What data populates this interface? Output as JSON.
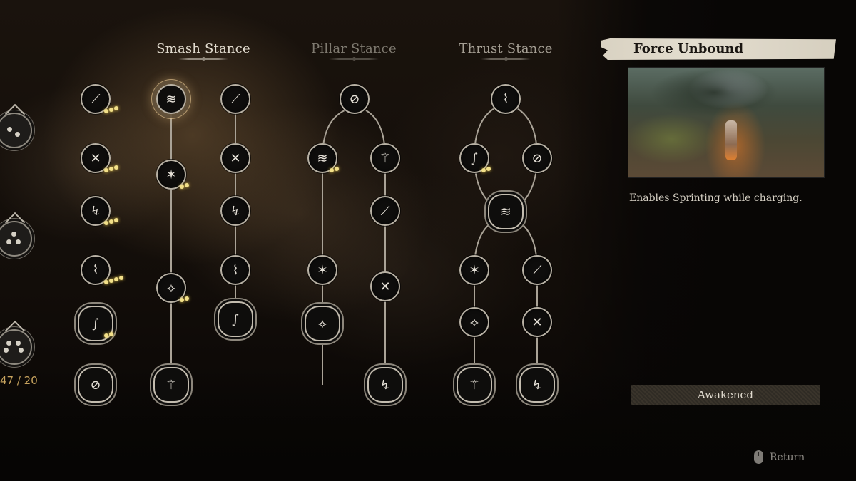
{
  "tabs": [
    {
      "label": "Smash Stance",
      "state": "active"
    },
    {
      "label": "Pillar Stance",
      "state": "inactive"
    },
    {
      "label": "Thrust Stance",
      "state": "inactive"
    }
  ],
  "sidebar": {
    "emblems": [
      {
        "name": "focus-level-2",
        "pips": 2
      },
      {
        "name": "focus-level-3",
        "pips": 3
      },
      {
        "name": "focus-level-4",
        "pips": 4
      }
    ],
    "points_label": "47 / 20"
  },
  "skill_trees": {
    "common_column": [
      {
        "icon": "orb-spin-icon",
        "cost": 3
      },
      {
        "icon": "staff-twirl-icon",
        "cost": 3
      },
      {
        "icon": "hook-strike-icon",
        "cost": 3
      },
      {
        "icon": "staff-charge-icon",
        "cost": 4
      },
      {
        "icon": "staff-coil-icon",
        "cost": 2,
        "type": "major"
      },
      {
        "icon": "staff-spin-icon",
        "cost": 0,
        "type": "major"
      }
    ],
    "smash": {
      "left": [
        {
          "icon": "smash-leap-icon",
          "state": "selected"
        },
        {
          "icon": "smash-shield-icon",
          "cost": 2
        },
        {
          "icon": "smash-burst-icon",
          "cost": 2
        },
        {
          "icon": "smash-finisher-icon",
          "type": "major"
        }
      ],
      "right": [
        {
          "icon": "cross-staff-icon"
        },
        {
          "icon": "deflect-icon"
        },
        {
          "icon": "crescent-icon"
        },
        {
          "icon": "crescent-focus-icon"
        },
        {
          "icon": "cross-focus-icon",
          "type": "major"
        }
      ]
    },
    "pillar": {
      "root": {
        "icon": "pillar-stand-icon"
      },
      "left": [
        {
          "icon": "pillar-grass-icon",
          "cost": 2
        },
        {
          "icon": "pillar-lean-icon"
        },
        {
          "icon": "pillar-swing-icon",
          "type": "major"
        }
      ],
      "right": [
        {
          "icon": "pillar-spin-icon"
        },
        {
          "icon": "pillar-whirl-icon"
        },
        {
          "icon": "pillar-cross-icon"
        },
        {
          "icon": "pillar-fan-icon",
          "type": "major"
        }
      ]
    },
    "thrust": {
      "root": {
        "icon": "thrust-line-icon"
      },
      "upper_left": {
        "icon": "thrust-wave-icon",
        "cost": 2
      },
      "upper_right": {
        "icon": "thrust-glide-icon"
      },
      "hub": {
        "icon": "force-unbound-icon",
        "type": "major"
      },
      "left": [
        {
          "icon": "thrust-pierce-icon"
        },
        {
          "icon": "thrust-feather-icon"
        },
        {
          "icon": "thrust-surge-icon",
          "type": "major"
        }
      ],
      "right": [
        {
          "icon": "thrust-sweep-icon"
        },
        {
          "icon": "thrust-ring-icon"
        },
        {
          "icon": "thrust-star-icon",
          "type": "major"
        }
      ]
    }
  },
  "detail": {
    "title": "Force Unbound",
    "description": "Enables Sprinting while charging.",
    "status_label": "Awakened"
  },
  "footer": {
    "return_label": "Return",
    "return_icon": "mouse-icon"
  },
  "colors": {
    "cost_dot": "#f2e08a",
    "node_border": "#b8b1a4",
    "points": "#c7a35e"
  }
}
